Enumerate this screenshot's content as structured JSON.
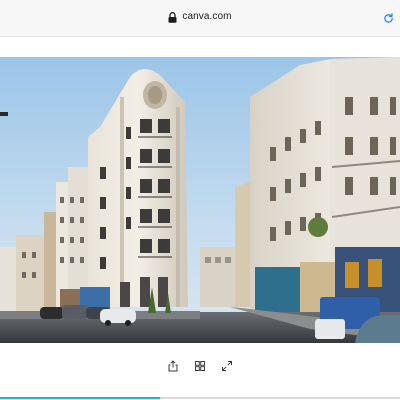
{
  "browser": {
    "url": "canva.com",
    "icons": {
      "lock": "lock-icon",
      "reload": "reload-icon"
    }
  },
  "photo": {
    "subject": "street-scene-photo"
  },
  "toolbar": {
    "buttons": [
      {
        "name": "share-button",
        "icon": "share-icon"
      },
      {
        "name": "grid-view-button",
        "icon": "grid-icon"
      },
      {
        "name": "fullscreen-button",
        "icon": "expand-icon"
      }
    ]
  },
  "progress": {
    "fraction": 0.4,
    "color": "#1fb6c9",
    "track_color": "#d9dadd"
  },
  "colors": {
    "accent": "#1fb6c9",
    "reload": "#2a7fff",
    "toolbar_icon": "#3a3a3c"
  }
}
